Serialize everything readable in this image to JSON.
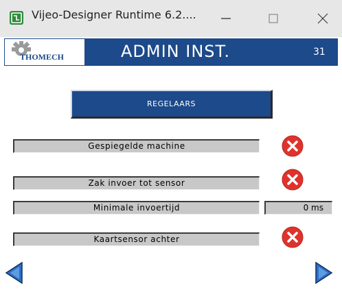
{
  "window": {
    "title": "Vijeo-Designer Runtime 6.2....",
    "minimize_glyph": "—",
    "maximize_glyph": "☐",
    "close_glyph": "✕"
  },
  "header": {
    "logo_text": "THOMECH",
    "title": "ADMIN INST.",
    "page_number": "31",
    "color": "#1c4a8a"
  },
  "regelaars_button": {
    "label": "REGELAARS"
  },
  "settings": [
    {
      "label": "Gespiegelde machine",
      "status_icon": "error-x-icon"
    },
    {
      "label": "Zak invoer tot sensor",
      "status_icon": "error-x-icon"
    },
    {
      "label": "Minimale invoertijd",
      "value": "0 ms"
    },
    {
      "label": "Kaartsensor achter",
      "status_icon": "error-x-icon"
    }
  ],
  "navigation": {
    "prev_icon": "left-arrow-icon",
    "next_icon": "right-arrow-icon"
  },
  "colors": {
    "status_error": "#e0322c",
    "accent": "#1c4a8a",
    "bar": "#c8c8c8"
  }
}
